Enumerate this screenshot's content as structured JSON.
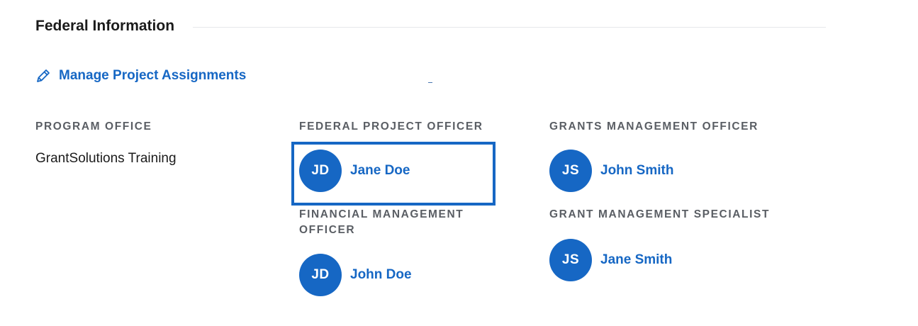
{
  "section": {
    "title": "Federal Information"
  },
  "manage_link": {
    "label": "Manage Project Assignments",
    "icon": "pencil-icon"
  },
  "program_office": {
    "heading": "PROGRAM OFFICE",
    "value": "GrantSolutions Training"
  },
  "federal_project_officer": {
    "heading": "FEDERAL PROJECT OFFICER",
    "initials": "JD",
    "name": "Jane Doe",
    "focused": true
  },
  "grants_management_officer": {
    "heading": "GRANTS MANAGEMENT OFFICER",
    "initials": "JS",
    "name": "John Smith"
  },
  "financial_management_officer": {
    "heading_line1": "FINANCIAL MANAGEMENT",
    "heading_line2": "OFFICER",
    "initials": "JD",
    "name": "John Doe"
  },
  "grant_management_specialist": {
    "heading": "GRANT MANAGEMENT SPECIALIST",
    "initials": "JS",
    "name": "Jane Smith"
  },
  "colors": {
    "accent": "#1667c4",
    "heading": "#5a5e64",
    "text": "#1b1b1b"
  }
}
